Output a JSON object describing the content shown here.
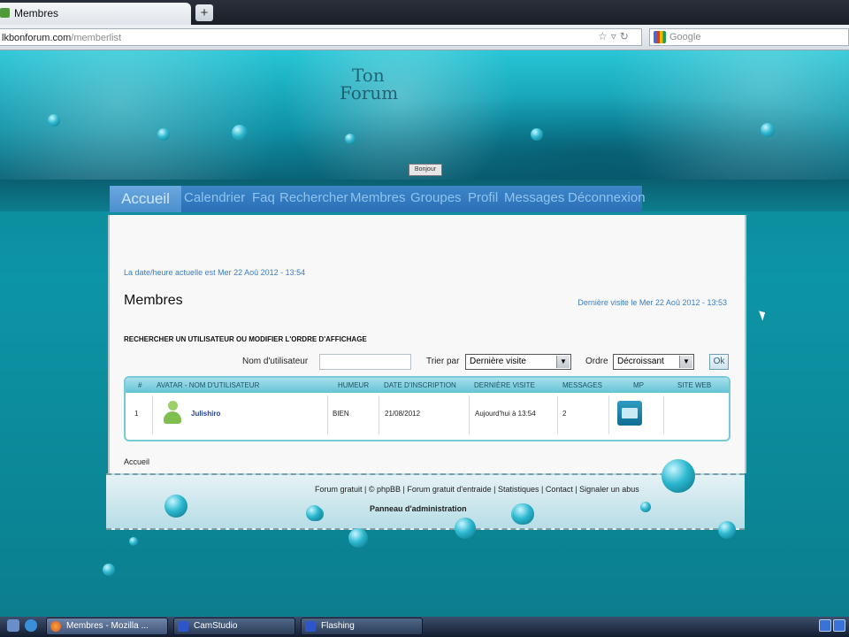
{
  "browser": {
    "tab_title": "Membres",
    "new_tab_symbol": "+",
    "url_domain": "lkbonforum.com",
    "url_path": "/memberlist",
    "search_placeholder": "Google"
  },
  "site": {
    "logo_line1": "Ton",
    "logo_line2": "Forum",
    "home_button": "Bonjour",
    "nav": [
      "Accueil",
      "Calendrier",
      "Faq",
      "Rechercher",
      "Membres",
      "Groupes",
      "Profil",
      "Messages",
      "Déconnexion"
    ]
  },
  "members": {
    "current_datetime": "La date/heure actuelle est Mer 22 Aoû 2012 - 13:54",
    "title": "Membres",
    "last_visit": "Dernière visite le Mer 22 Aoû 2012 - 13:53",
    "search_heading": "RECHERCHER UN UTILISATEUR OU MODIFIER L'ORDRE D'AFFICHAGE",
    "username_label": "Nom d'utilisateur",
    "username_value": "",
    "sort_label": "Trier par",
    "sort_value": "Dernière visite",
    "order_label": "Ordre",
    "order_value": "Décroissant",
    "ok_button": "Ok",
    "columns": [
      "#",
      "AVATAR - NOM D'UTILISATEUR",
      "HUMEUR",
      "DATE D'INSCRIPTION",
      "DERNIÈRE VISITE",
      "MESSAGES",
      "MP",
      "SITE WEB"
    ],
    "rows": [
      {
        "num": "1",
        "username": "Julishiro",
        "mood": "BIEN",
        "joined": "21/08/2012",
        "last_visit": "Aujourd'hui à 13:54",
        "messages": "2",
        "website": ""
      }
    ],
    "breadcrumb": "Accueil"
  },
  "footer": {
    "links": "Forum gratuit | © phpBB | Forum gratuit d'entraide | Statistiques | Contact | Signaler un abus",
    "admin_panel": "Panneau d'administration"
  },
  "taskbar": {
    "buttons": [
      "Membres - Mozilla ...",
      "CamStudio",
      "Flashing"
    ]
  },
  "colors": {
    "accent": "#0f93a8",
    "nav_bg": "#2a6fb6",
    "link": "#3a7ec2"
  }
}
